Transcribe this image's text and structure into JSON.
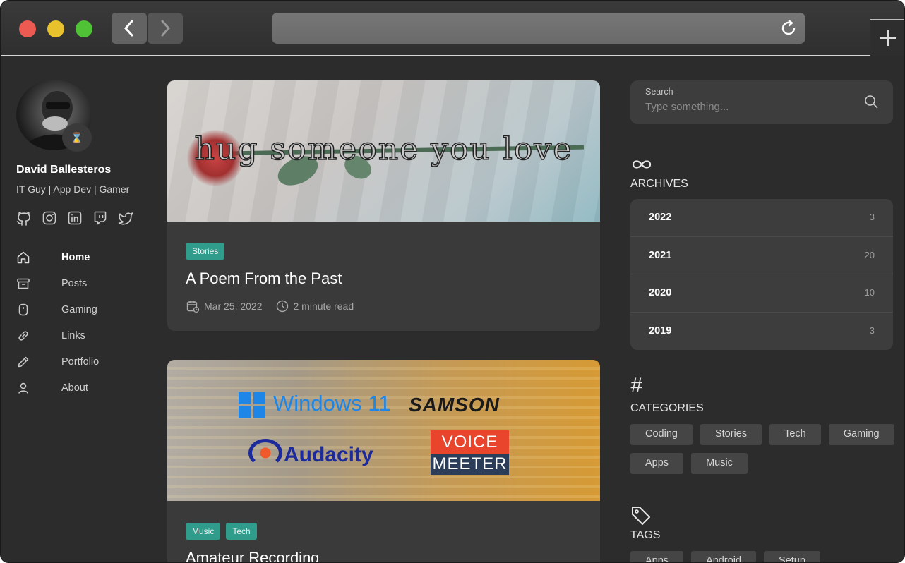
{
  "browser": {
    "url": ""
  },
  "profile": {
    "name": "David Ballesteros",
    "bio": "IT Guy | App Dev | Gamer",
    "badge": "⌛",
    "socials": [
      "github-icon",
      "instagram-icon",
      "linkedin-icon",
      "twitch-icon",
      "twitter-icon"
    ]
  },
  "nav": [
    {
      "label": "Home",
      "icon": "home-icon",
      "active": true
    },
    {
      "label": "Posts",
      "icon": "archive-box-icon"
    },
    {
      "label": "Gaming",
      "icon": "mouse-icon"
    },
    {
      "label": "Links",
      "icon": "link-icon"
    },
    {
      "label": "Portfolio",
      "icon": "pencil-icon"
    },
    {
      "label": "About",
      "icon": "user-icon"
    }
  ],
  "posts": [
    {
      "image_text": "hug someone you love",
      "tags": [
        "Stories"
      ],
      "title": "A Poem From the Past",
      "date": "Mar 25, 2022",
      "read_time": "2 minute read"
    },
    {
      "image_logos": {
        "windows": "Windows 11",
        "samson": "SAMSON",
        "audacity": "Audacity",
        "voicemeeter_top": "VOICE",
        "voicemeeter_bottom": "MEETER"
      },
      "tags": [
        "Music",
        "Tech"
      ],
      "title": "Amateur Recording"
    }
  ],
  "search": {
    "label": "Search",
    "placeholder": "Type something..."
  },
  "archives": {
    "title": "ARCHIVES",
    "items": [
      {
        "year": "2022",
        "count": "3"
      },
      {
        "year": "2021",
        "count": "20"
      },
      {
        "year": "2020",
        "count": "10"
      },
      {
        "year": "2019",
        "count": "3"
      }
    ]
  },
  "categories": {
    "icon": "#",
    "title": "CATEGORIES",
    "items": [
      "Coding",
      "Stories",
      "Tech",
      "Gaming",
      "Apps",
      "Music"
    ]
  },
  "tags": {
    "title": "TAGS",
    "items": [
      "Apps",
      "Android",
      "Setup"
    ]
  },
  "colors": {
    "accent": "#2f9c8c",
    "background": "#2c2c2c",
    "card": "#3a3a3a"
  }
}
